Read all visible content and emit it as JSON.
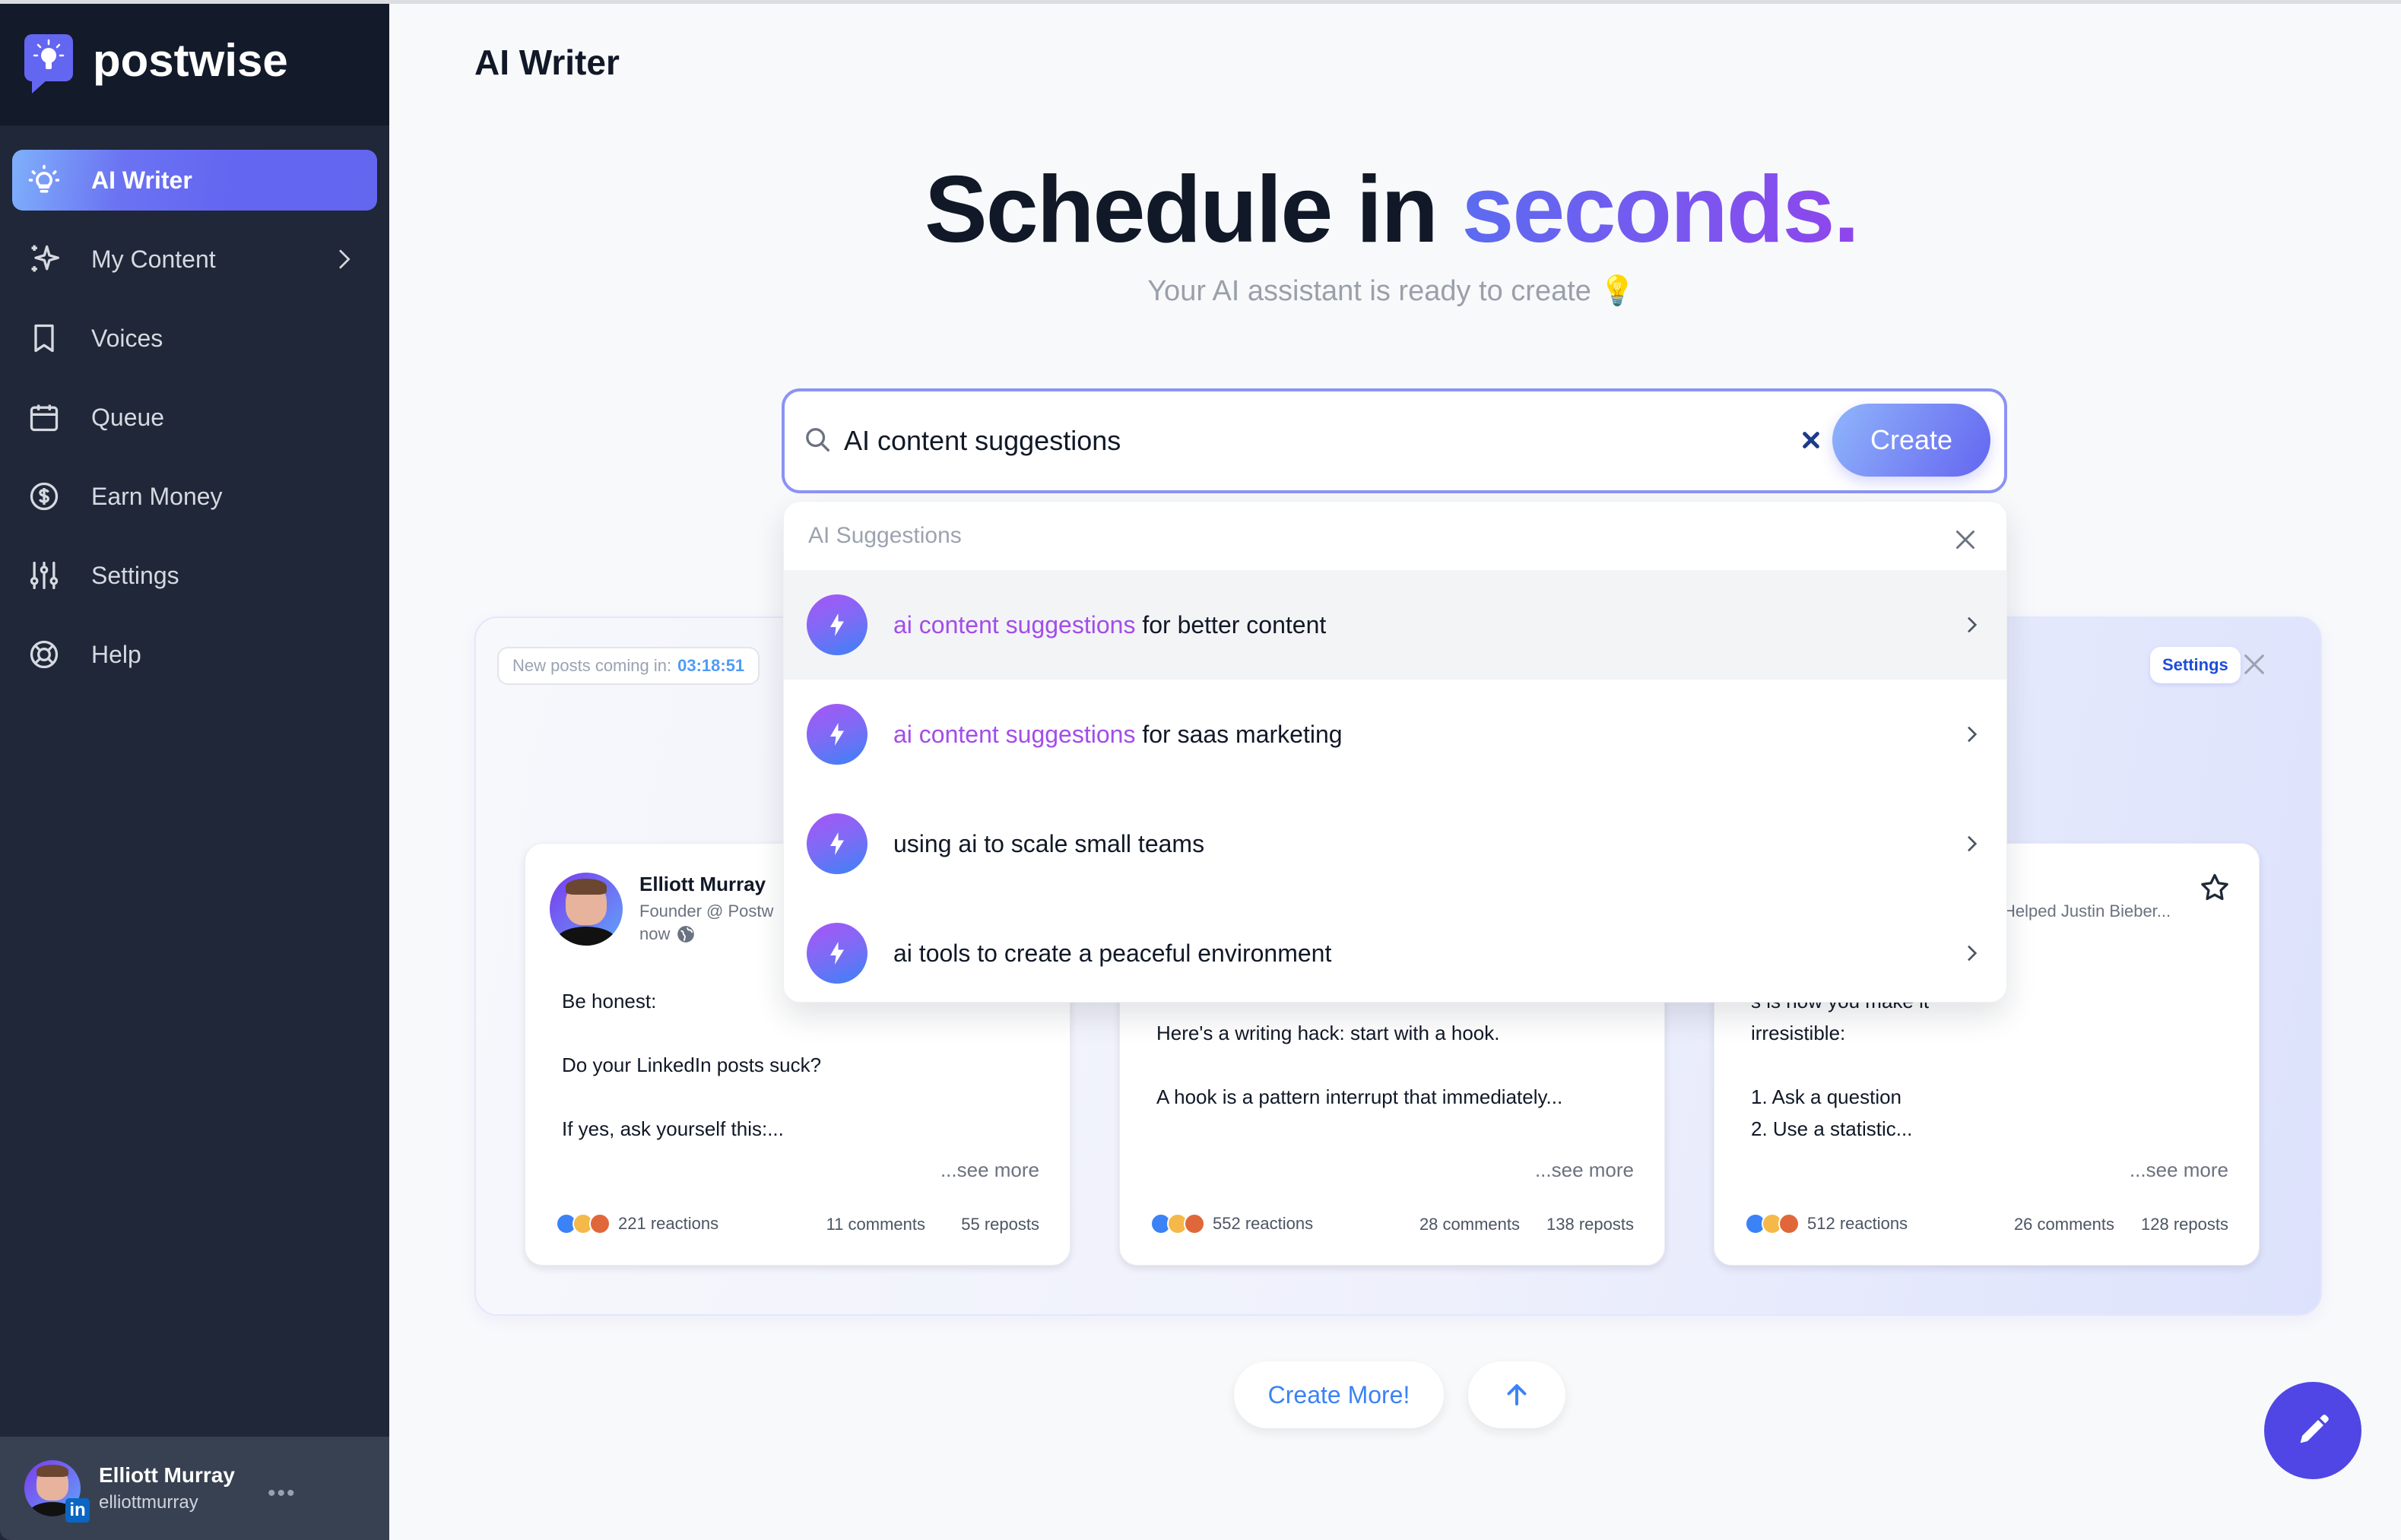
{
  "app": {
    "brand": "postwise"
  },
  "sidebar": {
    "items": [
      {
        "label": "AI Writer",
        "icon": "lightbulb-icon",
        "active": true
      },
      {
        "label": "My Content",
        "icon": "sparkles-icon",
        "has_chevron": true
      },
      {
        "label": "Voices",
        "icon": "bookmark-icon"
      },
      {
        "label": "Queue",
        "icon": "calendar-icon"
      },
      {
        "label": "Earn Money",
        "icon": "dollar-circle-icon"
      },
      {
        "label": "Settings",
        "icon": "sliders-icon"
      },
      {
        "label": "Help",
        "icon": "lifebuoy-icon"
      }
    ],
    "profile": {
      "name": "Elliott Murray",
      "handle": "elliottmurray",
      "network_badge": "in",
      "more": "•••"
    }
  },
  "header": {
    "title": "AI Writer"
  },
  "hero": {
    "title_plain": "Schedule in ",
    "title_accent": "seconds.",
    "subtitle": "Your AI assistant is ready to create 💡"
  },
  "search": {
    "value": "AI content suggestions",
    "placeholder": "",
    "create_label": "Create"
  },
  "suggestions": {
    "title": "AI Suggestions",
    "items": [
      {
        "highlight": "ai content suggestions",
        "rest": " for better content"
      },
      {
        "highlight": "ai content suggestions",
        "rest": " for saas marketing"
      },
      {
        "highlight": "",
        "rest": "using ai to scale small teams"
      },
      {
        "highlight": "",
        "rest": "ai tools to create a peaceful environment"
      }
    ]
  },
  "feed": {
    "countdown_label": "New posts coming in:",
    "countdown_time": "03:18:51",
    "settings_label": "Settings",
    "posts": [
      {
        "author": "Elliott Murray",
        "headline": "Founder @ Postw",
        "time": "now",
        "body": "Be honest:\n\nDo your LinkedIn posts suck?\n\nIf yes, ask yourself this:...",
        "see_more": "...see more",
        "reactions": "221 reactions",
        "comments": "11 comments",
        "reposts": "55 reposts"
      },
      {
        "author": "",
        "headline": "",
        "time": "",
        "body": "\nHere's a writing hack: start with a hook.\n\nA hook is a pattern interrupt that immediately...",
        "see_more": "...see more",
        "reactions": "552 reactions",
        "comments": "28 comments",
        "reposts": "138 reposts"
      },
      {
        "author": "",
        "headline": "Helped Justin Bieber...",
        "time": "",
        "body": "                              s is how you make it\nirresistible:\n\n1. Ask a question\n2. Use a statistic...",
        "see_more": "...see more",
        "reactions": "512 reactions",
        "comments": "26 comments",
        "reposts": "128 reposts"
      }
    ]
  },
  "actions": {
    "create_more": "Create More!"
  },
  "colors": {
    "accent": "#6366f1",
    "sidebar_bg": "#1f2738",
    "highlight_purple": "#a24de9",
    "link_blue": "#3b82f6",
    "fab": "#4f46e5"
  }
}
